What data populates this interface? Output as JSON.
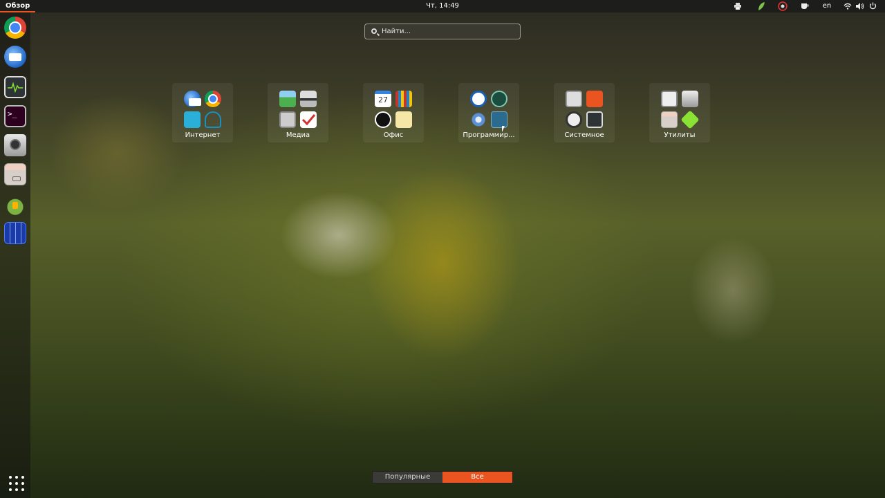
{
  "topbar": {
    "activities_label": "Обзор",
    "clock": "Чт, 14:49",
    "tray": {
      "printer_icon": "printer-icon",
      "app1_icon": "leaf-icon",
      "app2_icon": "recording-icon",
      "app3_icon": "cup-icon",
      "language": "en",
      "wifi_icon": "wifi-icon",
      "volume_icon": "volume-icon",
      "power_icon": "power-icon"
    }
  },
  "dock": {
    "items": [
      "chrome-icon",
      "thunderbird-icon",
      "system-monitor-icon",
      "terminal-icon",
      "camera-icon",
      "files-drawer-icon",
      "android-icon",
      "virtualbox-icon"
    ],
    "terminal_glyph": ">_",
    "show_apps_icon": "app-grid-icon"
  },
  "search": {
    "placeholder": "Найти..."
  },
  "folders": [
    {
      "label": "Интернет"
    },
    {
      "label": "Медиа"
    },
    {
      "label": "Офис"
    },
    {
      "label": "Программир..."
    },
    {
      "label": "Системное"
    },
    {
      "label": "Утилиты"
    }
  ],
  "office_calendar_day": "27",
  "view_switch": {
    "popular": "Популярные",
    "all": "Все"
  },
  "colors": {
    "accent": "#e95420",
    "topbar": "#1d1d1b"
  }
}
